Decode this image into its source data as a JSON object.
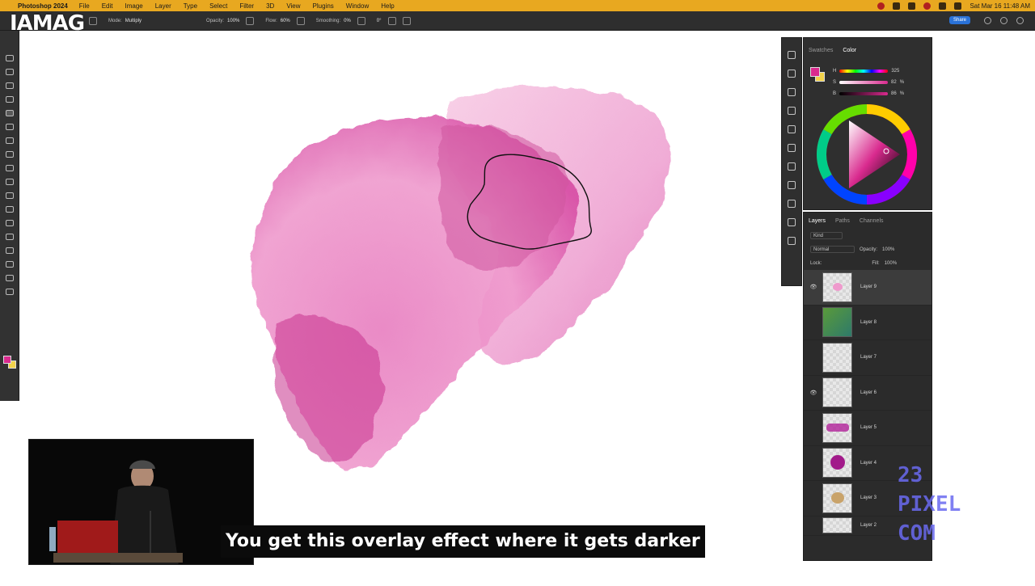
{
  "menubar": {
    "app_name": "Photoshop 2024",
    "menus": [
      "File",
      "Edit",
      "Image",
      "Layer",
      "Type",
      "Select",
      "Filter",
      "3D",
      "View",
      "Plugins",
      "Window",
      "Help"
    ],
    "clock": "Sat Mar 16  11:48 AM"
  },
  "options_bar": {
    "mode_label": "Mode:",
    "mode_value": "Multiply",
    "opacity_label": "Opacity:",
    "opacity_value": "100%",
    "flow_label": "Flow:",
    "flow_value": "60%",
    "smoothing_label": "Smoothing:",
    "smoothing_value": "0%",
    "angle_value": "0°",
    "share_label": "Share"
  },
  "overlay_logo": {
    "text": "IAMAG",
    "sub": "MA"
  },
  "color_panel": {
    "tabs": [
      "Swatches",
      "Color"
    ],
    "active_tab": "Color",
    "h_label": "H",
    "h_value": "325",
    "s_label": "S",
    "s_value": "82",
    "b_label": "B",
    "b_value": "86",
    "unit": "%",
    "foreground_color": "#d92a8e",
    "background_color": "#f2d24a"
  },
  "layers_panel": {
    "tabs": [
      "Layers",
      "Paths",
      "Channels"
    ],
    "active_tab": "Layers",
    "filter_label": "Kind",
    "blend_mode": "Normal",
    "opacity_label": "Opacity:",
    "opacity_value": "100%",
    "lock_label": "Lock:",
    "fill_label": "Fill:",
    "fill_value": "100%",
    "layers": [
      {
        "name": "Layer 9",
        "visible": true,
        "selected": true
      },
      {
        "name": "Layer 8",
        "visible": false,
        "selected": false
      },
      {
        "name": "Layer 7",
        "visible": false,
        "selected": false
      },
      {
        "name": "Layer 6",
        "visible": true,
        "selected": false
      },
      {
        "name": "Layer 5",
        "visible": false,
        "selected": false
      },
      {
        "name": "Layer 4",
        "visible": false,
        "selected": false
      },
      {
        "name": "Layer 3",
        "visible": false,
        "selected": false
      },
      {
        "name": "Layer 2",
        "visible": false,
        "selected": false
      }
    ]
  },
  "caption": "You get this overlay effect where it gets darker",
  "watermark": {
    "line1": "23",
    "line2": "PIXEL",
    "line3": "COM"
  },
  "colors": {
    "accent_pink": "#d92a8e",
    "menubar": "#e8a820"
  }
}
